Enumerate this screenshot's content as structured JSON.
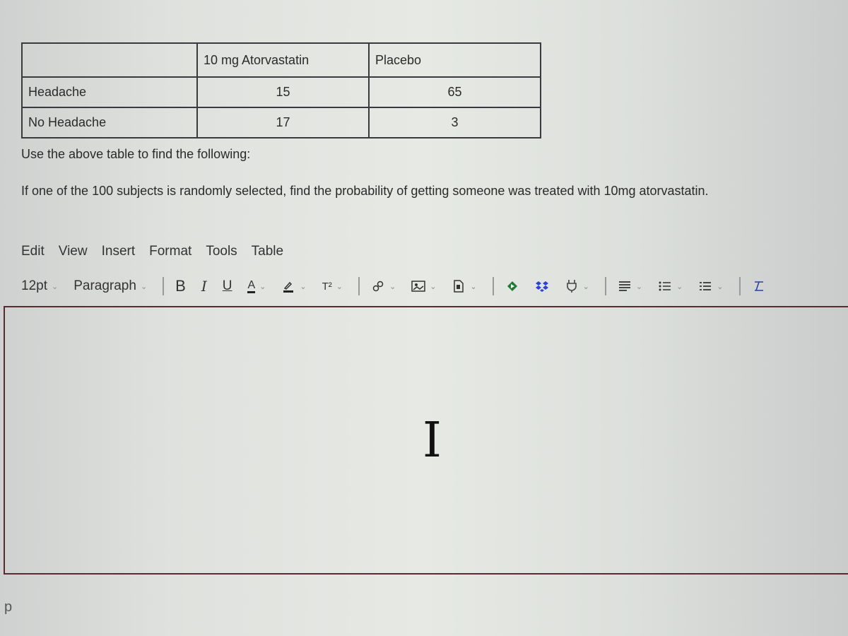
{
  "table": {
    "headers": [
      "",
      "10 mg Atorvastatin",
      "Placebo"
    ],
    "rows": [
      {
        "label": "Headache",
        "values": [
          "15",
          "65"
        ]
      },
      {
        "label": "No Headache",
        "values": [
          "17",
          "3"
        ]
      }
    ]
  },
  "question": {
    "instruction": "Use the above table to find the following:",
    "prompt": "If one of the 100 subjects is randomly selected, find the probability of getting someone was treated with 10mg atorvastatin."
  },
  "editor": {
    "menu": [
      "Edit",
      "View",
      "Insert",
      "Format",
      "Tools",
      "Table"
    ],
    "font_size": "12pt",
    "block_format": "Paragraph",
    "toolbar": {
      "bold": "B",
      "italic": "I",
      "underline": "U",
      "text_color": "A",
      "superscript": "T²",
      "chevron": "⌄"
    },
    "content": "",
    "status_path": "p",
    "colors": {
      "border": "#5a2a32",
      "drive_green": "#1e7a35",
      "dropbox_blue": "#2c3fd6"
    }
  }
}
